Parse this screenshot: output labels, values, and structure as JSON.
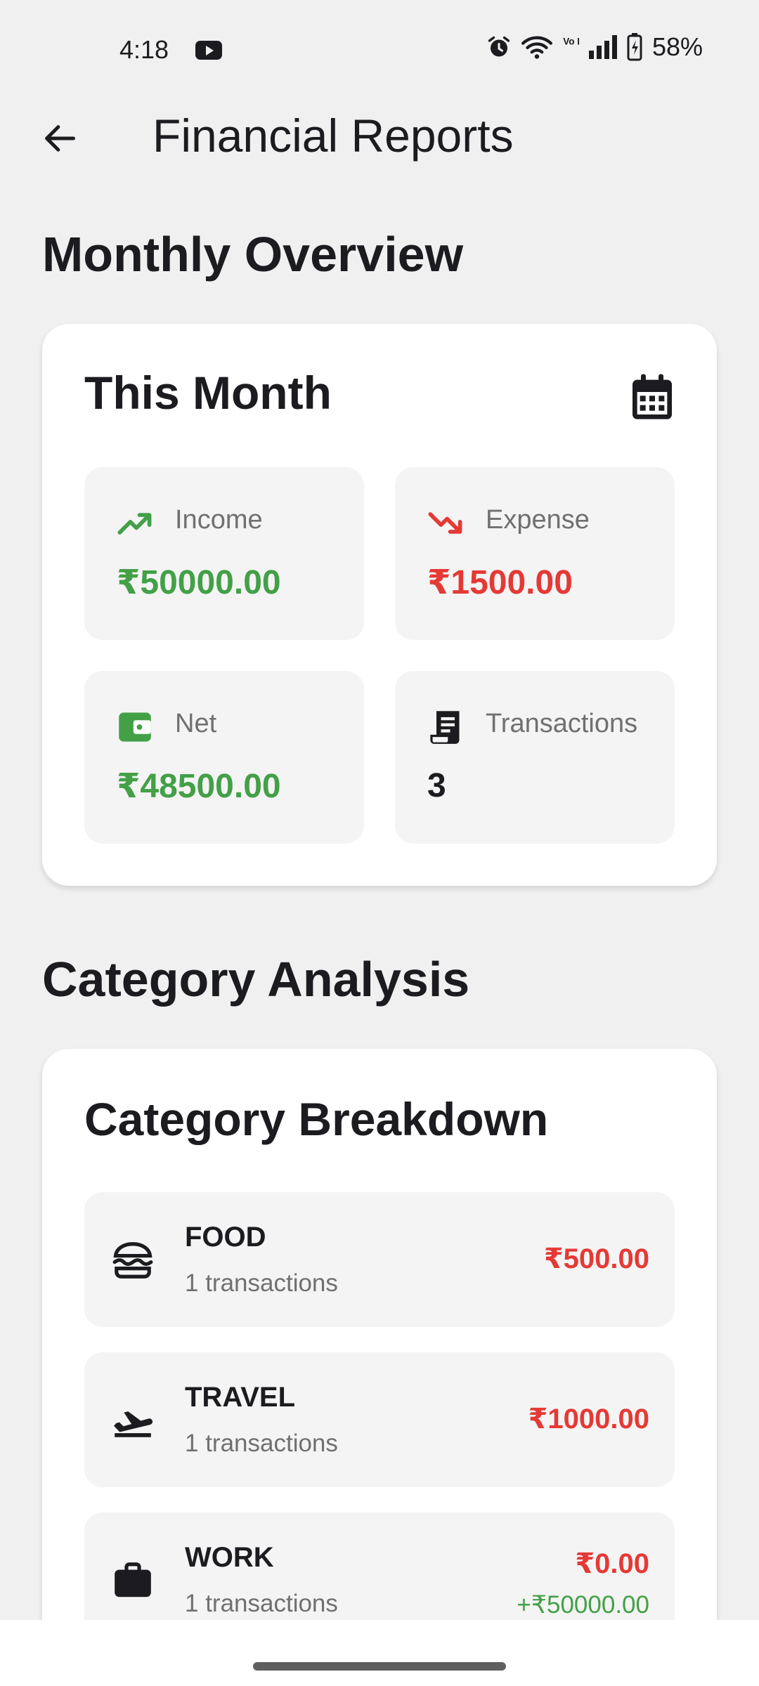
{
  "status_bar": {
    "time": "4:18",
    "battery": "58%",
    "network_label": "Vo LTE"
  },
  "app_bar": {
    "title": "Financial Reports"
  },
  "monthly_overview": {
    "section_title": "Monthly Overview",
    "card_title": "This Month",
    "stats": [
      {
        "label": "Income",
        "value": "₹50000.00",
        "color": "#43a047",
        "icon": "trending-up-icon"
      },
      {
        "label": "Expense",
        "value": "₹1500.00",
        "color": "#e53935",
        "icon": "trending-down-icon"
      },
      {
        "label": "Net",
        "value": "₹48500.00",
        "color": "#43a047",
        "icon": "wallet-icon"
      },
      {
        "label": "Transactions",
        "value": "3",
        "color": "#1c1b1f",
        "icon": "receipt-icon"
      }
    ]
  },
  "category_analysis": {
    "section_title": "Category Analysis",
    "card_title": "Category Breakdown",
    "categories": [
      {
        "name": "FOOD",
        "count": "1 transactions",
        "amount": "₹500.00",
        "icon": "burger-icon"
      },
      {
        "name": "TRAVEL",
        "count": "1 transactions",
        "amount": "₹1000.00",
        "icon": "flight-takeoff-icon"
      },
      {
        "name": "WORK",
        "count": "1 transactions",
        "amount": "₹0.00",
        "income": "+₹50000.00",
        "icon": "briefcase-icon"
      }
    ]
  },
  "colors": {
    "income": "#43a047",
    "expense": "#e53935",
    "background": "#f0f0f0",
    "card": "#ffffff",
    "tile": "#f4f4f4"
  }
}
